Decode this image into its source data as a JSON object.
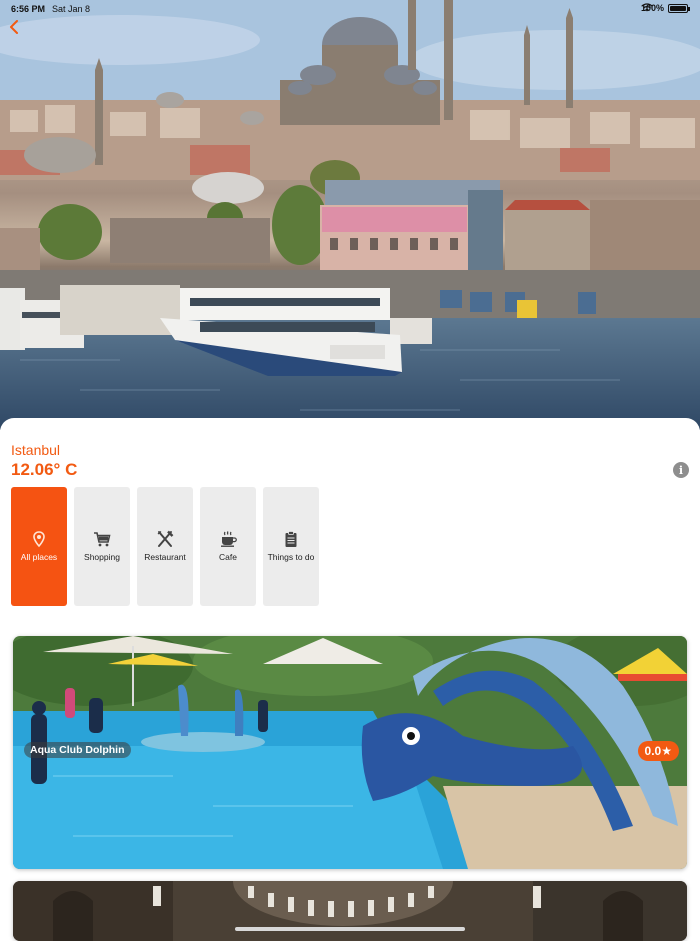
{
  "status_bar": {
    "time": "6:56 PM",
    "date": "Sat Jan 8",
    "battery": "100%"
  },
  "header": {
    "back_icon": "chevron-left-icon"
  },
  "location": {
    "city": "Istanbul",
    "temperature": "12.06° C",
    "info_icon": "info-icon"
  },
  "categories": [
    {
      "label": "All places",
      "icon": "map-pin-icon",
      "active": true
    },
    {
      "label": "Shopping",
      "icon": "cart-icon",
      "active": false
    },
    {
      "label": "Restaurant",
      "icon": "fork-knife-icon",
      "active": false
    },
    {
      "label": "Cafe",
      "icon": "coffee-cup-icon",
      "active": false
    },
    {
      "label": "Things to do",
      "icon": "clipboard-icon",
      "active": false
    }
  ],
  "places": [
    {
      "name": "Aqua Club Dolphin",
      "rating": "0.0★"
    }
  ],
  "colors": {
    "accent": "#f25a12",
    "tile_bg": "#ececec",
    "active_tile": "#f55312"
  }
}
